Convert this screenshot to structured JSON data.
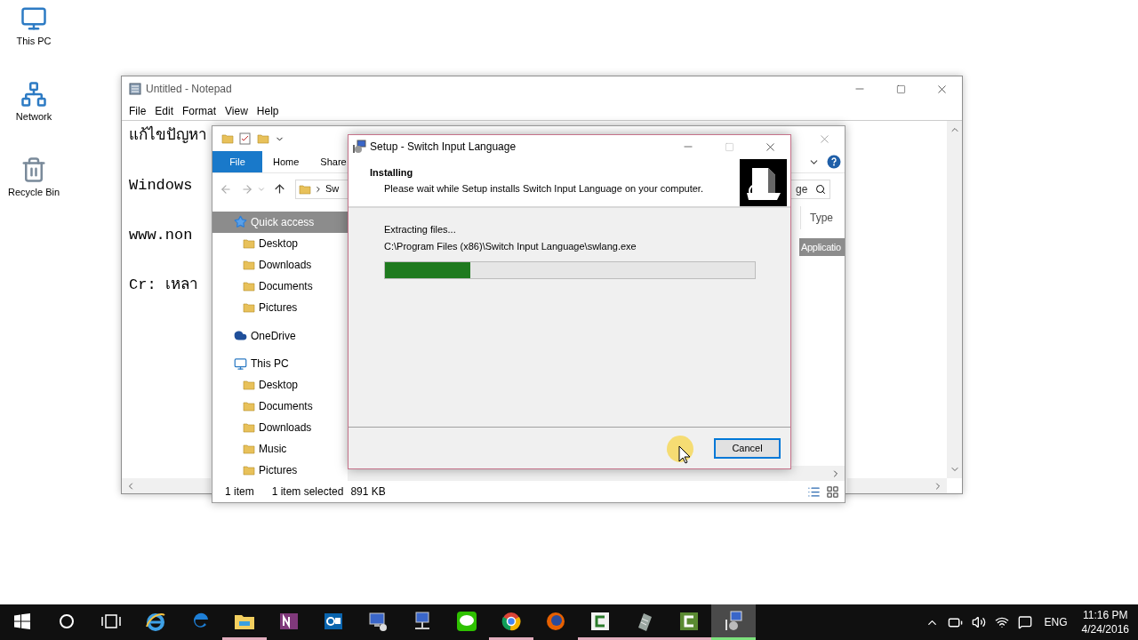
{
  "desktop_icons": [
    {
      "label": "This PC",
      "kind": "pc"
    },
    {
      "label": "Network",
      "kind": "network"
    },
    {
      "label": "Recycle Bin",
      "kind": "bin"
    }
  ],
  "notepad": {
    "title": "Untitled - Notepad",
    "menu": [
      "File",
      "Edit",
      "Format",
      "View",
      "Help"
    ],
    "lines": [
      "แก้ไขปัญหา",
      "Windows",
      "www.non",
      "Cr: เหลา"
    ]
  },
  "explorer": {
    "ribbon_tabs": [
      {
        "label": "File",
        "kind": "backstage"
      },
      {
        "label": "Home",
        "kind": "tab"
      },
      {
        "label": "Share",
        "kind": "tab"
      }
    ],
    "address": "Sw",
    "search_value": "ge",
    "nav": [
      {
        "label": "Quick access",
        "kind": "star",
        "selected": true,
        "children": [
          {
            "label": "Desktop",
            "kind": "folder",
            "selected": false
          },
          {
            "label": "Downloads",
            "kind": "folder",
            "selected": false
          },
          {
            "label": "Documents",
            "kind": "folder",
            "selected": false
          },
          {
            "label": "Pictures",
            "kind": "folder",
            "selected": false
          }
        ]
      },
      {
        "label": "OneDrive",
        "kind": "cloud",
        "selected": false
      },
      {
        "label": "This PC",
        "kind": "pc",
        "selected": false,
        "children": [
          {
            "label": "Desktop",
            "kind": "folder",
            "selected": false
          },
          {
            "label": "Documents",
            "kind": "folder",
            "selected": false
          },
          {
            "label": "Downloads",
            "kind": "folder",
            "selected": false
          },
          {
            "label": "Music",
            "kind": "folder",
            "selected": false
          },
          {
            "label": "Pictures",
            "kind": "folder",
            "selected": false
          }
        ]
      }
    ],
    "columns": [
      "Type"
    ],
    "rows": [
      {
        "type": "Applicatio",
        "selected": true
      }
    ],
    "status": [
      "1 item",
      "1 item selected",
      "891 KB"
    ]
  },
  "setup": {
    "title": "Setup - Switch Input Language",
    "heading": "Installing",
    "subheading": "Please wait while Setup installs Switch Input Language on your computer.",
    "status": "Extracting files...",
    "path": "C:\\Program Files (x86)\\Switch Input Language\\swlang.exe",
    "progress": {
      "level": 0.23
    },
    "buttons": [
      {
        "label": "Cancel",
        "focused": true
      }
    ]
  },
  "taskbar": {
    "items": [
      {
        "kind": "start",
        "running": false,
        "active": false
      },
      {
        "kind": "search",
        "running": false,
        "active": false
      },
      {
        "kind": "taskview",
        "running": false,
        "active": false
      },
      {
        "kind": "ie",
        "running": false,
        "active": false
      },
      {
        "kind": "edge",
        "running": false,
        "active": false
      },
      {
        "kind": "explorer",
        "running": true,
        "active": false
      },
      {
        "kind": "onenote",
        "running": false,
        "active": false
      },
      {
        "kind": "outlook",
        "running": false,
        "active": false
      },
      {
        "kind": "remote",
        "running": false,
        "active": false
      },
      {
        "kind": "network",
        "running": false,
        "active": false
      },
      {
        "kind": "line",
        "running": false,
        "active": false
      },
      {
        "kind": "chrome",
        "running": true,
        "active": false
      },
      {
        "kind": "firefox",
        "running": false,
        "active": false
      },
      {
        "kind": "camtasia",
        "running": true,
        "active": false
      },
      {
        "kind": "notepad",
        "running": true,
        "active": false
      },
      {
        "kind": "recorder",
        "running": true,
        "active": false
      },
      {
        "kind": "setup",
        "running": true,
        "active": true
      }
    ],
    "language": "ENG",
    "time": "11:16 PM",
    "date": "4/24/2016"
  }
}
